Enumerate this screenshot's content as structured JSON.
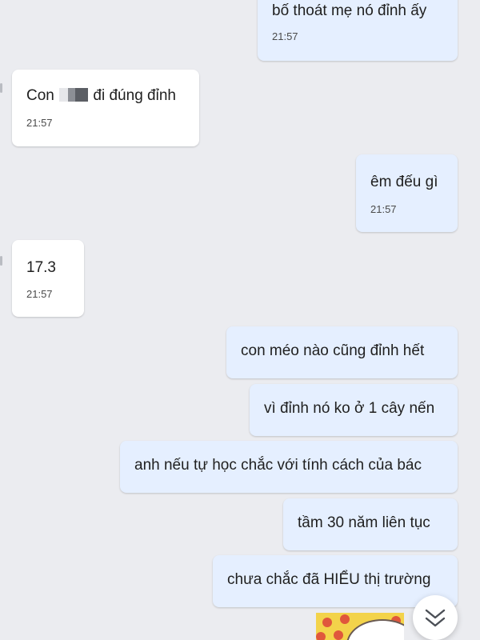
{
  "messages": [
    {
      "text": "bố thoát mẹ nó đỉnh ấy",
      "time": "21:57"
    },
    {
      "prefix": "Con",
      "suffix": "đi đúng đỉnh",
      "time": "21:57"
    },
    {
      "text": "êm đếu gì",
      "time": "21:57"
    },
    {
      "text": "17.3",
      "time": "21:57"
    },
    {
      "text": "con méo nào cũng đỉnh hết"
    },
    {
      "text": "vì đỉnh nó ko ở 1 cây nến"
    },
    {
      "text": "anh nếu tự học chắc với tính cách của bác"
    },
    {
      "text": "tầm 30 năm liên tục"
    },
    {
      "text": "chưa chắc đã HIỂU thị trường"
    }
  ],
  "icons": {
    "scroll_down": "chevron-double-down-icon",
    "censor": "redaction-mark"
  },
  "colors": {
    "background": "#ebecf0",
    "incoming": "#ffffff",
    "outgoing": "#e5efff",
    "sticker": "#f3d34a"
  }
}
